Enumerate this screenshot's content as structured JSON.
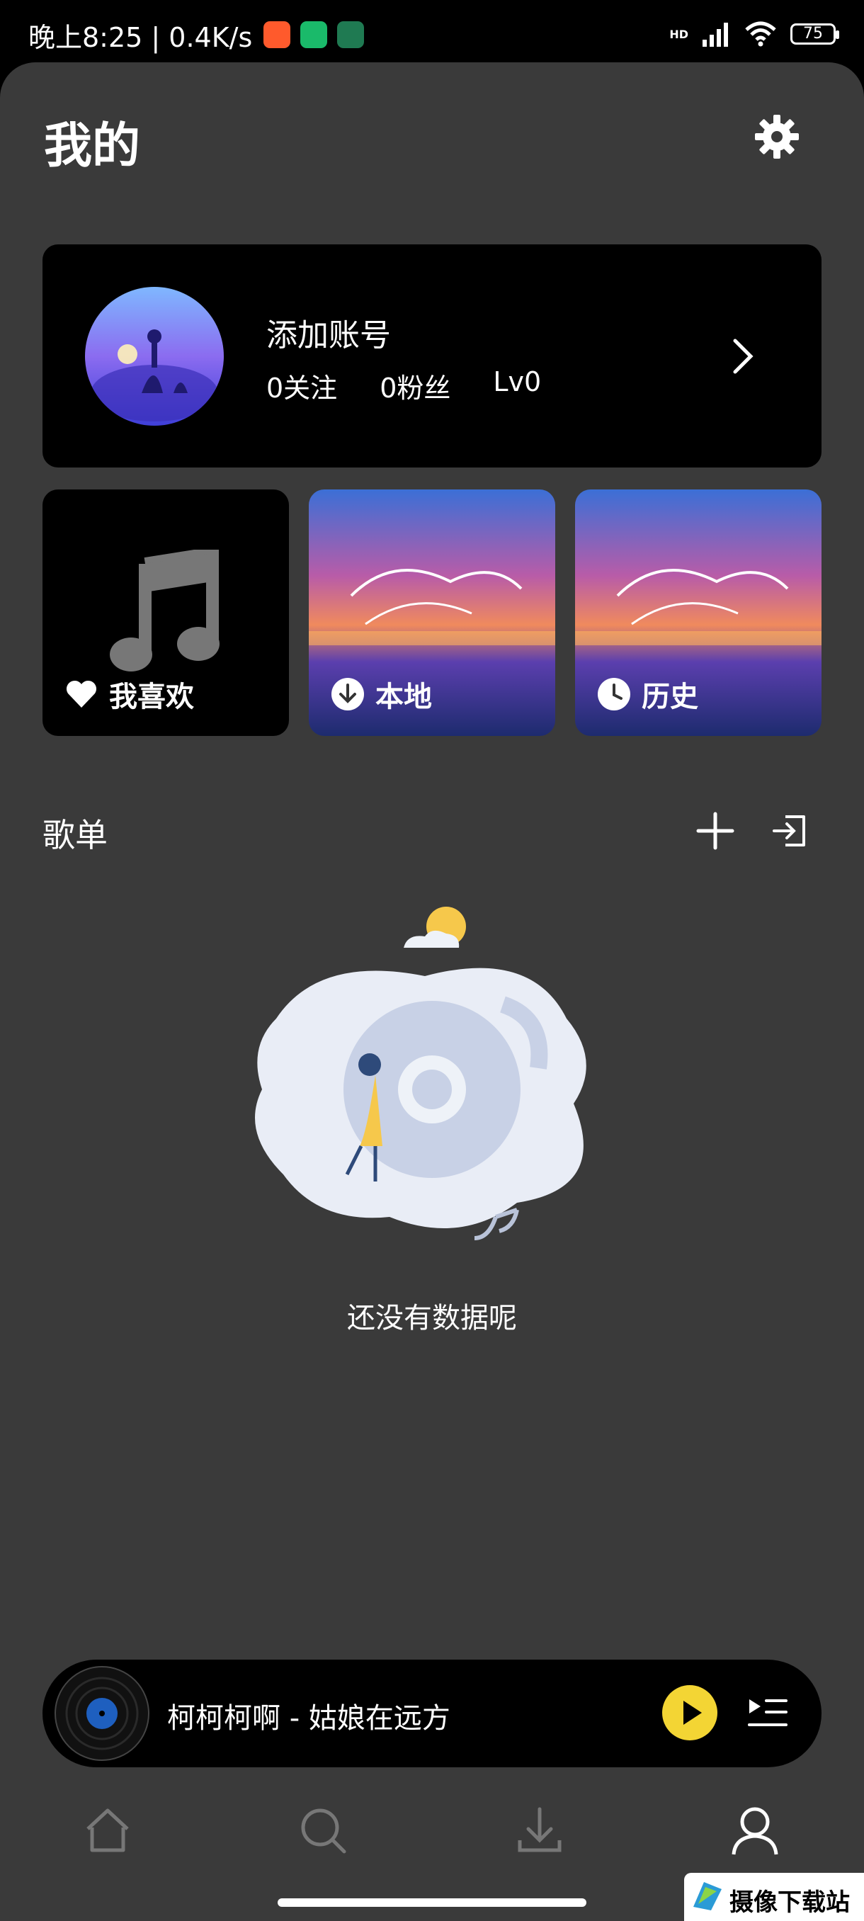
{
  "status_bar": {
    "time_speed": "晚上8:25 | 0.4K/s",
    "network": "HD",
    "battery": "75"
  },
  "page": {
    "title": "我的"
  },
  "account": {
    "name": "添加账号",
    "stats": [
      "0关注",
      "0粉丝",
      "Lv0"
    ]
  },
  "tiles": [
    {
      "label": "我喜欢",
      "icon": "heart-icon"
    },
    {
      "label": "本地",
      "icon": "download-circle-icon"
    },
    {
      "label": "历史",
      "icon": "clock-icon"
    }
  ],
  "playlists": {
    "title": "歌单",
    "empty_text": "还没有数据呢"
  },
  "player": {
    "song": "柯柯柯啊 - 姑娘在远方",
    "accent": "#f3d534"
  },
  "nav": [
    "home-icon",
    "search-icon",
    "download-icon",
    "profile-icon"
  ],
  "watermark": {
    "text": "摄像下载站"
  }
}
